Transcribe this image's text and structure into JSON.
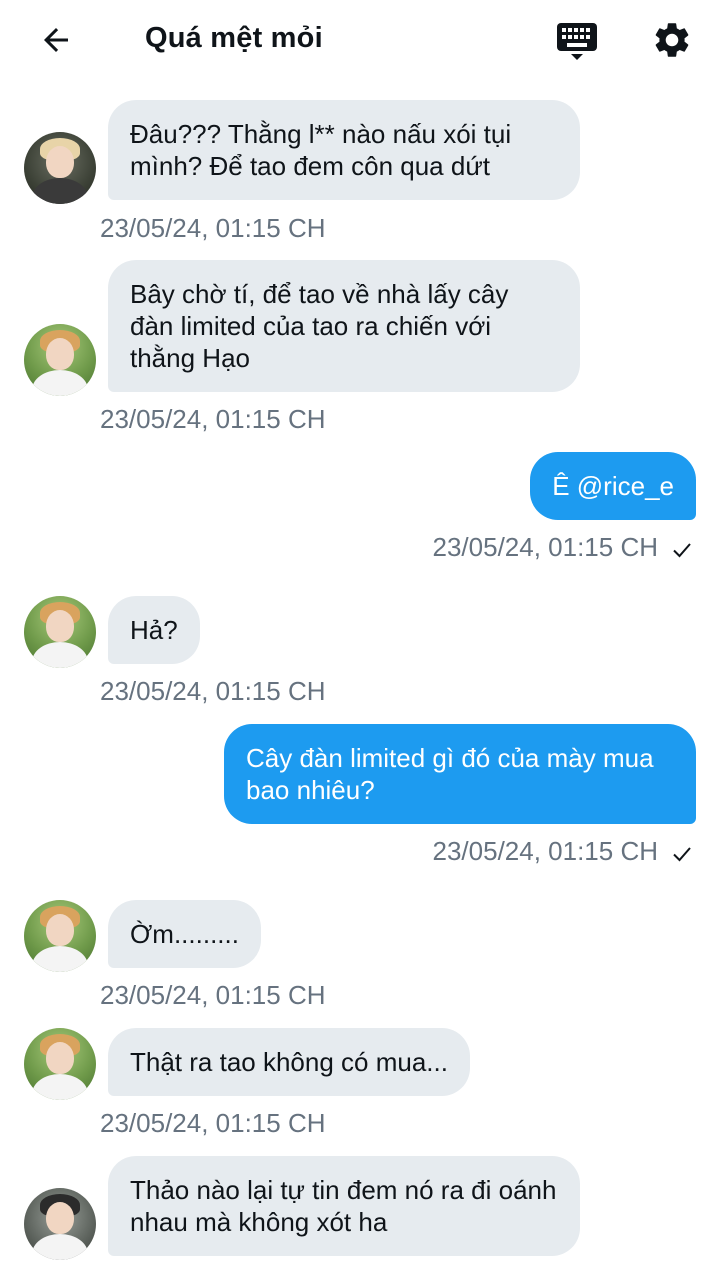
{
  "header": {
    "title": "Quá mệt mỏi",
    "back_icon": "arrow-left-icon",
    "keyboard_icon": "keyboard-icon",
    "settings_icon": "gear-icon"
  },
  "colors": {
    "outgoing_bubble": "#1d9bf0",
    "incoming_bubble": "#e6ebef",
    "timestamp": "#66727f"
  },
  "messages": [
    {
      "dir": "in",
      "text": "Đâu??? Thằng l** nào nấu xói tụi mình? Để tao đem côn qua dứt",
      "time": "23/05/24, 01:15 CH"
    },
    {
      "dir": "in",
      "text": "Bây chờ tí, để tao về nhà lấy cây đàn limited của tao ra chiến với thằng Hạo",
      "time": "23/05/24, 01:15 CH"
    },
    {
      "dir": "out",
      "text": "Ê @rice_e",
      "time": "23/05/24, 01:15 CH"
    },
    {
      "dir": "in",
      "text": "Hả?",
      "time": "23/05/24, 01:15 CH"
    },
    {
      "dir": "out",
      "text": "Cây đàn limited gì đó của mày mua bao nhiêu?",
      "time": "23/05/24, 01:15 CH"
    },
    {
      "dir": "in",
      "text": "Ờm.........",
      "time": "23/05/24, 01:15 CH"
    },
    {
      "dir": "in",
      "text": "Thật ra tao không có mua...",
      "time": "23/05/24, 01:15 CH"
    },
    {
      "dir": "in",
      "text": "Thảo nào lại tự tin đem nó ra đi oánh nhau mà không xót ha",
      "time": ""
    }
  ]
}
